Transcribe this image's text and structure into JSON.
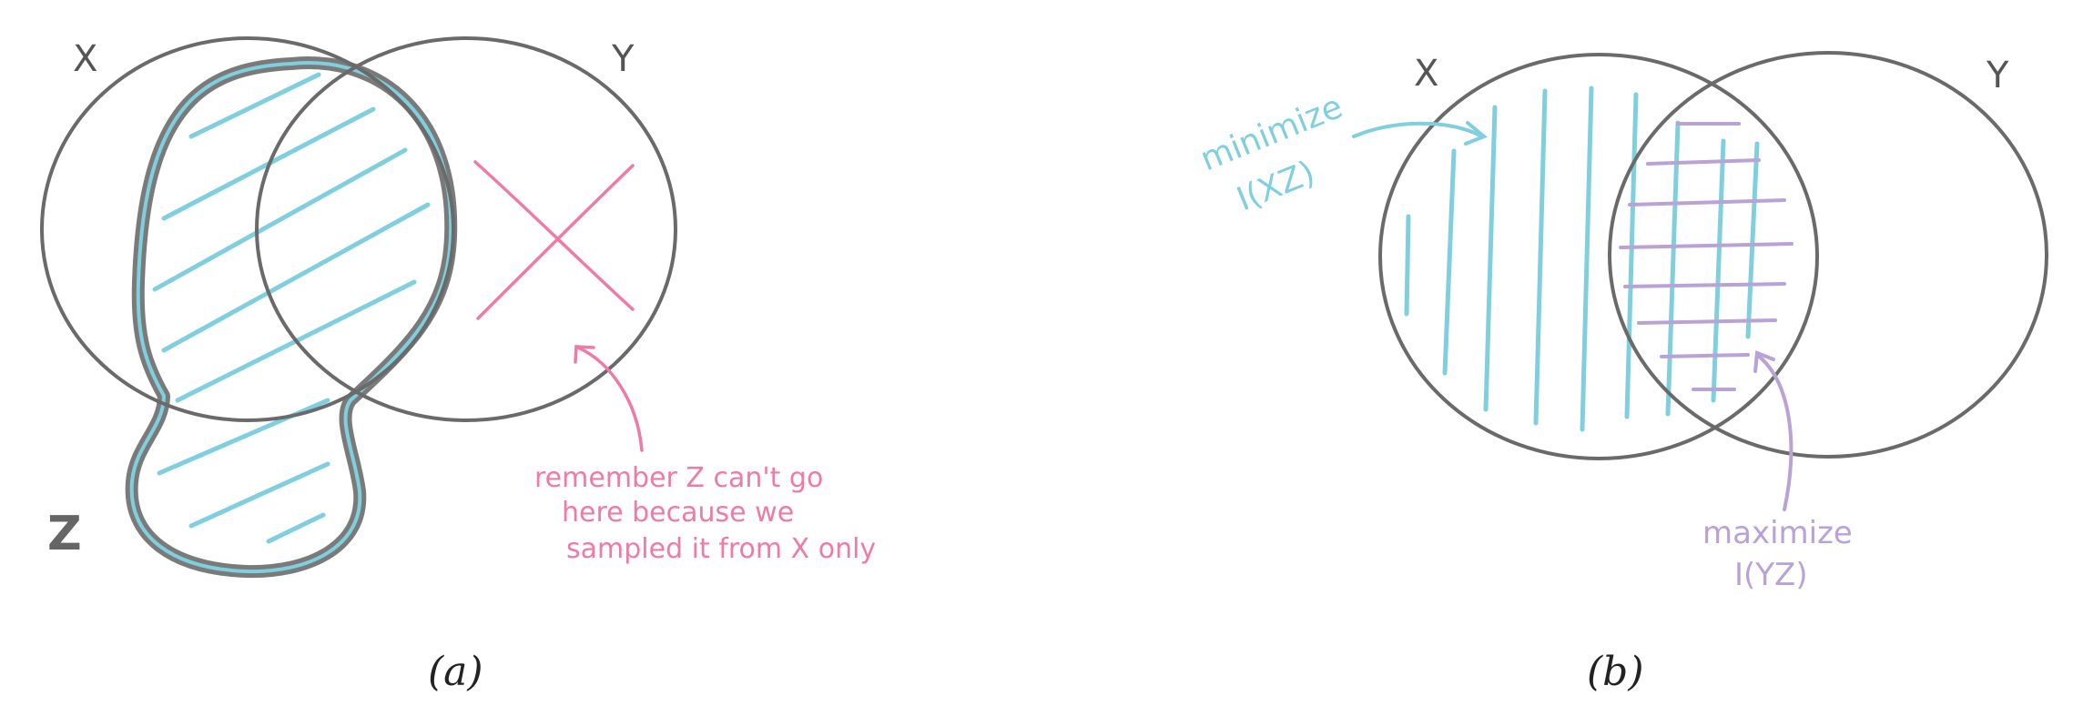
{
  "panel_a": {
    "label_x": "X",
    "label_y": "Y",
    "label_z": "Z",
    "note_line1": "remember Z can't go",
    "note_line2": "here because we",
    "note_line3": "sampled it from X only",
    "caption": "(a)"
  },
  "panel_b": {
    "label_x": "X",
    "label_y": "Y",
    "minimize_line1": "minimize",
    "minimize_line2": "I(XZ)",
    "maximize_line1": "maximize",
    "maximize_line2": "I(YZ)",
    "caption": "(b)"
  },
  "colors": {
    "outline": "#6a6a6a",
    "z_blob": "#7fcfde",
    "note_pink": "#ef7aa6",
    "minimize": "#7fcfde",
    "maximize": "#b9a2d6"
  }
}
